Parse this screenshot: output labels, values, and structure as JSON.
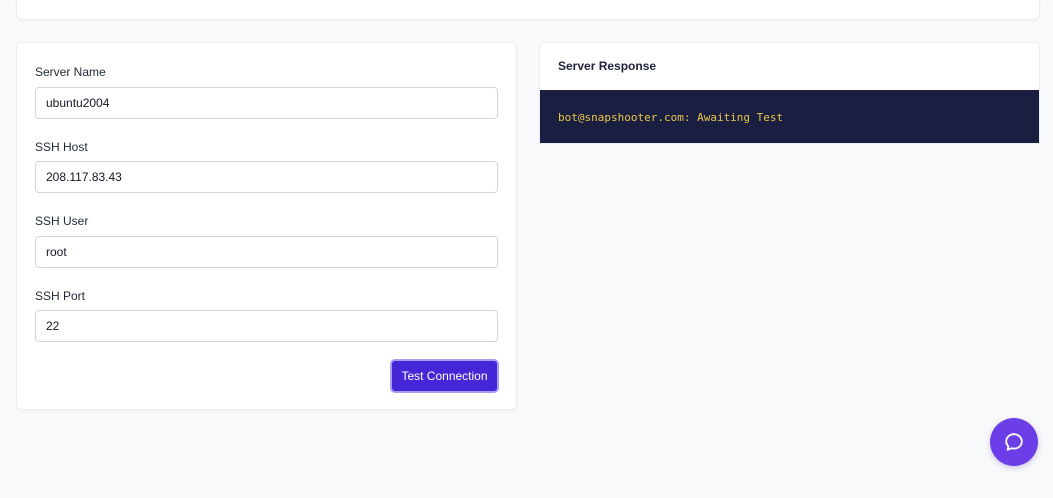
{
  "form": {
    "fields": [
      {
        "label": "Server Name",
        "value": "ubuntu2004"
      },
      {
        "label": "SSH Host",
        "value": "208.117.83.43"
      },
      {
        "label": "SSH User",
        "value": "root"
      },
      {
        "label": "SSH Port",
        "value": "22"
      }
    ],
    "submit_label": "Test Connection"
  },
  "response": {
    "title": "Server Response",
    "terminal_text": "bot@snapshooter.com: Awaiting Test"
  },
  "help": {
    "icon": "chat-bubble-icon"
  },
  "colors": {
    "accent": "#4527d8",
    "help": "#6b3ee8",
    "terminal_bg": "#1a1f42",
    "terminal_text": "#e8c547"
  }
}
